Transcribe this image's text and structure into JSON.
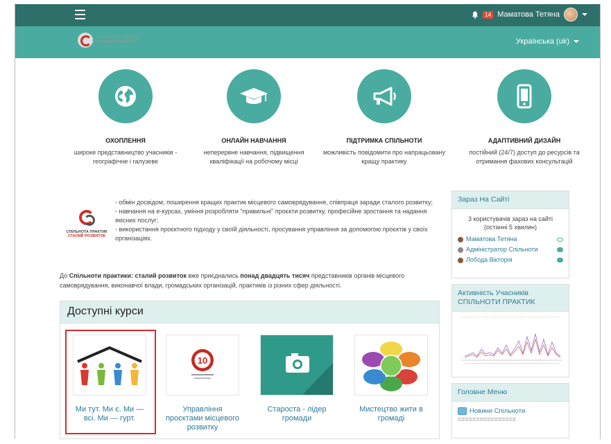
{
  "header": {
    "notifications_count": "14",
    "user_name": "Маматова Тетяна"
  },
  "brand": {
    "line1": "СПІЛЬНОТА ПРАКТИК",
    "line2": "СТАЛИЙ РОЗВИТОК",
    "language": "Українська (uk)"
  },
  "features": [
    {
      "title": "ОХОПЛЕННЯ",
      "text": "широке представництво учасників - географічне і галузеве",
      "icon": "globe-icon"
    },
    {
      "title": "ОНЛАЙН НАВЧАННЯ",
      "text": "неперервне навчання, підвищення кваліфікації на робочому місці",
      "icon": "graduation-cap-icon"
    },
    {
      "title": "ПІДТРИМКА СПІЛЬНОТИ",
      "text": "можливість повідомити про напрацьовану кращу практику",
      "icon": "megaphone-icon"
    },
    {
      "title": "АДАПТИВНИЙ ДИЗАЙН",
      "text": "постійний (24/7) доступ до ресурсів та отримання фахових консультацій",
      "icon": "mobile-icon"
    }
  ],
  "about": {
    "logo_line1": "СПІЛЬНОТА ПРАКТИК",
    "logo_line2": "СТАЛИЙ РОЗВИТОК",
    "bullets": [
      "- обмін досвідом, поширення кращих практик місцевого самоврядування, співпраця заради сталого розвитку;",
      "- навчання на е-курсах, уміння розробляти \"правильні\" проєкти розвитку, професійне зростання та надання якісних послуг;",
      "- використання проєктного підходу у своїй діяльності, просування управління за допомогою проєктів у своїх організаціях."
    ],
    "intro_prefix": "До ",
    "intro_bold1": "Спільноти практики: сталий розвиток",
    "intro_middle": " вже приєднались ",
    "intro_bold2": "понад двадцять тисяч",
    "intro_suffix": " представників органів місцевого самоврядування, виконавчої влади, громадських організацій, практиків із різних сфер діяльності."
  },
  "courses": {
    "heading": "Доступні курси",
    "items": [
      {
        "title": "Ми тут. Ми є. Ми — всі. Ми — гурт."
      },
      {
        "title": "Управління проєктами місцевого розвитку",
        "badge": "10"
      },
      {
        "title": "Староста - лідер громади"
      },
      {
        "title": "Мистецтво жити в громаді"
      }
    ]
  },
  "sidebar": {
    "online": {
      "heading": "Зараз На Сайті",
      "info": "3 користувачів зараз на сайті (останні 5 хвилин)",
      "users": [
        "Маматова Тетяна",
        "Адміністратор Спільноти",
        "Лобода Вікторія"
      ]
    },
    "activity": {
      "heading": "Активність Учасників СПІЛЬНОТИ ПРАКТИК"
    },
    "main_menu": {
      "heading": "Головне Меню",
      "item": "Новини Спільноти",
      "divider": "================"
    }
  }
}
